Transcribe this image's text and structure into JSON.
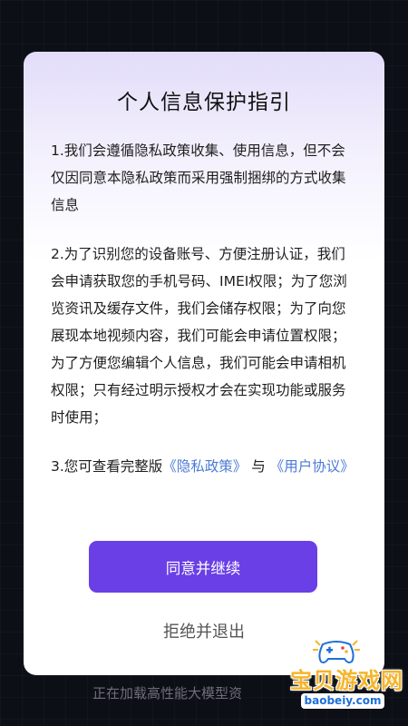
{
  "dialog": {
    "title": "个人信息保护指引",
    "paragraph1": "1.我们会遵循隐私政策收集、使用信息，但不会仅因同意本隐私政策而采用强制捆绑的方式收集信息",
    "paragraph2": "2.为了识别您的设备账号、方便注册认证，我们会申请获取您的手机号码、IMEI权限；为了您浏览资讯及缓存文件，我们会储存权限；为了向您展现本地视频内容，我们可能会申请位置权限；为了方便您编辑个人信息，我们可能会申请相机权限；只有经过明示授权才会在实现功能或服务时使用；",
    "paragraph3_prefix": "3.您可查看完整版",
    "privacy_link": "《隐私政策》",
    "paragraph3_and": "与",
    "user_agreement_link": "《用户协议》",
    "agree_button": "同意并继续",
    "reject_button": "拒绝并退出"
  },
  "loading_text": "正在加载高性能大模型资",
  "watermark": {
    "name": "宝贝游戏网",
    "domain": "baobeiy.com",
    "icon": "gamepad-icon"
  },
  "colors": {
    "accent": "#6a3fe6",
    "link": "#4b7bd6",
    "background": "#0d0f17",
    "watermark_gold": "#f5b52a",
    "watermark_blue": "#1d6fd8"
  }
}
